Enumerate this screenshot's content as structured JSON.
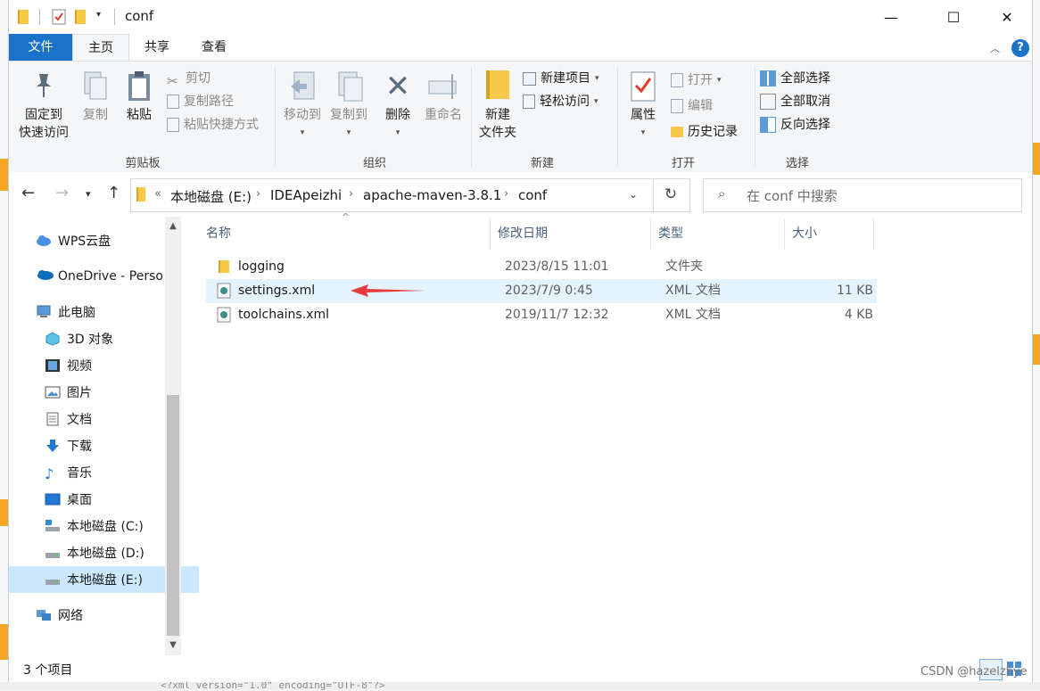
{
  "window": {
    "title": "conf",
    "controls": {
      "minimize": "—",
      "maximize": "☐",
      "close": "✕"
    }
  },
  "ribbon_tabs": [
    "文件",
    "主页",
    "共享",
    "查看"
  ],
  "ribbon": {
    "clipboard": {
      "label": "剪贴板",
      "pin": "固定到\n快速访问",
      "pin_line1": "固定到",
      "pin_line2": "快速访问",
      "copy": "复制",
      "paste": "粘贴",
      "cut": "剪切",
      "copy_path": "复制路径",
      "paste_shortcut": "粘贴快捷方式"
    },
    "organize": {
      "label": "组织",
      "move_to": "移动到",
      "copy_to": "复制到",
      "delete": "删除",
      "rename": "重命名"
    },
    "new": {
      "label": "新建",
      "new_folder_line1": "新建",
      "new_folder_line2": "文件夹",
      "new_item": "新建项目",
      "easy_access": "轻松访问"
    },
    "open": {
      "label": "打开",
      "properties": "属性",
      "open": "打开",
      "edit": "编辑",
      "history": "历史记录"
    },
    "select": {
      "label": "选择",
      "select_all": "全部选择",
      "select_none": "全部取消",
      "invert": "反向选择"
    }
  },
  "address": {
    "overflow": "«",
    "crumbs": [
      "本地磁盘 (E:)",
      "IDEApeizhi",
      "apache-maven-3.8.1",
      "conf"
    ],
    "search_placeholder": "在 conf 中搜索"
  },
  "nav_pane": [
    {
      "label": "WPS云盘",
      "icon": "cloud-icon"
    },
    {
      "label": "OneDrive - Perso",
      "icon": "onedrive-icon"
    },
    {
      "label": "此电脑",
      "icon": "computer-icon"
    },
    {
      "label": "3D 对象",
      "icon": "3d-objects-icon"
    },
    {
      "label": "视频",
      "icon": "video-icon"
    },
    {
      "label": "图片",
      "icon": "pictures-icon"
    },
    {
      "label": "文档",
      "icon": "documents-icon"
    },
    {
      "label": "下载",
      "icon": "download-icon"
    },
    {
      "label": "音乐",
      "icon": "music-icon"
    },
    {
      "label": "桌面",
      "icon": "desktop-icon"
    },
    {
      "label": "本地磁盘 (C:)",
      "icon": "drive-icon"
    },
    {
      "label": "本地磁盘 (D:)",
      "icon": "drive-icon"
    },
    {
      "label": "本地磁盘 (E:)",
      "icon": "drive-icon",
      "selected": true
    },
    {
      "label": "网络",
      "icon": "network-icon"
    }
  ],
  "columns": {
    "name": "名称",
    "modified": "修改日期",
    "type": "类型",
    "size": "大小"
  },
  "files": [
    {
      "name": "logging",
      "modified": "2023/8/15 11:01",
      "type": "文件夹",
      "size": "",
      "icon": "folder-icon"
    },
    {
      "name": "settings.xml",
      "modified": "2023/7/9 0:45",
      "type": "XML 文档",
      "size": "11 KB",
      "icon": "xml-file-icon",
      "selected": true
    },
    {
      "name": "toolchains.xml",
      "modified": "2019/11/7 12:32",
      "type": "XML 文档",
      "size": "4 KB",
      "icon": "xml-file-icon"
    }
  ],
  "status": {
    "item_count": "3 个项目"
  },
  "watermark": "CSDN @hazelzhye",
  "background_code": "<?xml version=\"1.0\" encoding=\"UTF-8\"?>",
  "colors": {
    "file_tab": "#1a73c8",
    "selection": "#cce8ff",
    "row_selection": "#e5f3ff",
    "arrow": "#e63b3b",
    "folder": "#f6c94a"
  }
}
